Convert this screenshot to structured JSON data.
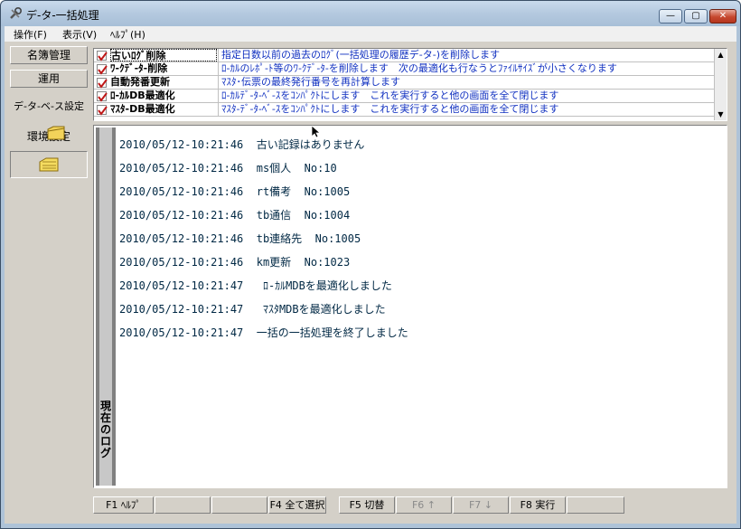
{
  "window": {
    "title": "デ-タ-一括処理",
    "buttons": {
      "minimize": "—",
      "maximize": "▢",
      "close": "✕"
    }
  },
  "menu": [
    {
      "label": "操作(F)"
    },
    {
      "label": "表示(V)"
    },
    {
      "label": "ﾍﾙﾌﾟ(H)"
    }
  ],
  "sidebar": {
    "buttons": [
      {
        "label": "名簿管理"
      },
      {
        "label": "運用"
      }
    ],
    "labels": [
      "デ-タ-ベ-ス設定",
      "環境設定"
    ]
  },
  "tasks": [
    {
      "name": "古いﾛｸﾞ削除",
      "desc": "指定日数以前の過去のﾛｸﾞ(一括処理の履歴デ-タ-)を削除します",
      "checked": true
    },
    {
      "name": "ﾜ-ｸﾃﾞ-ﾀ-削除",
      "desc": "ﾛ-ｶﾙのﾚﾎﾟ-ﾄ等のﾜ-ｸﾃﾞ-ﾀ-を削除します　次の最適化も行なうとﾌｧｲﾙｻｲｽﾞが小さくなります",
      "checked": true
    },
    {
      "name": "自動発番更新",
      "desc": "ﾏｽﾀ･伝票の最終発行番号を再計算します",
      "checked": true
    },
    {
      "name": "ﾛ-ｶﾙDB最適化",
      "desc": "ﾛ-ｶﾙﾃﾞ-ﾀ-ﾍﾞ-ｽをｺﾝﾊﾟｸﾄにします　これを実行すると他の画面を全て閉じます",
      "checked": true
    },
    {
      "name": "ﾏｽﾀ-DB最適化",
      "desc": "ﾏｽﾀ-ﾃﾞ-ﾀ-ﾍﾞ-ｽをｺﾝﾊﾟｸﾄにします　これを実行すると他の画面を全て閉じます",
      "checked": true
    }
  ],
  "log_panel": {
    "tab_label": "現在のログ",
    "lines": [
      "2010/05/12-10:21:46  古い記録はありません",
      "2010/05/12-10:21:46  ms個人  No:10",
      "2010/05/12-10:21:46  rt備考  No:1005",
      "2010/05/12-10:21:46  tb通信  No:1004",
      "2010/05/12-10:21:46  tb連絡先  No:1005",
      "2010/05/12-10:21:46  km更新  No:1023",
      "2010/05/12-10:21:47   ﾛ-ｶﾙMDBを最適化しました",
      "2010/05/12-10:21:47   ﾏｽﾀMDBを最適化しました",
      "2010/05/12-10:21:47  一括の一括処理を終了しました"
    ]
  },
  "function_keys": [
    {
      "label": "F1 ﾍﾙﾌﾟ",
      "enabled": true
    },
    {
      "label": "",
      "enabled": true
    },
    {
      "label": "",
      "enabled": true
    },
    {
      "label": "F4 全て選択",
      "enabled": true
    },
    {
      "label": "F5 切替",
      "enabled": true
    },
    {
      "label": "F6 ↑",
      "enabled": false
    },
    {
      "label": "F7 ↓",
      "enabled": false
    },
    {
      "label": "F8 実行",
      "enabled": true
    },
    {
      "label": "",
      "enabled": true
    }
  ],
  "icons": {
    "app": "tools-icon",
    "checkbox": "checkmark-icon",
    "folder": "folder-icon",
    "cursor": "mouse-cursor-icon"
  },
  "colors": {
    "titlebar": "#b4c9df",
    "task_desc": "#1030c0",
    "log_text": "#002844",
    "checkmark": "#c01818",
    "face": "#d4d0c8"
  }
}
